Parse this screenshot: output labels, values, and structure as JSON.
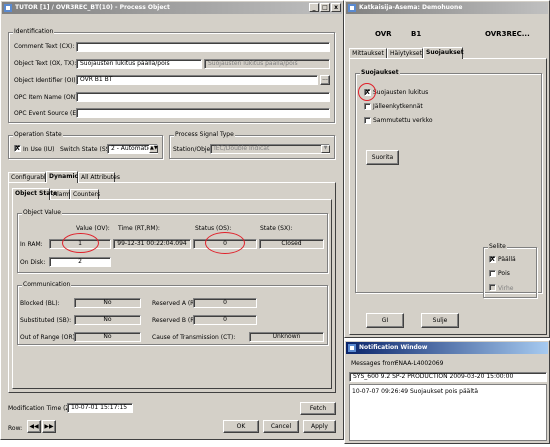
{
  "process_window": {
    "title": "TUTOR [1] / OVR3REC_BT(10) - Process Object",
    "identification": {
      "group_title": "Identification",
      "comment_text_label": "Comment Text (CX):",
      "comment_text_value": "",
      "object_text_label": "Object Text (OX, TX):",
      "object_text_value": "Suojausten lukitus päällä/pois",
      "object_text_value2": "Suojausten lukitus päällä/pois",
      "object_identifier_label": "Object Identifier (OI):",
      "object_identifier_value": "OVR      B1        BT",
      "opc_item_label": "OPC Item Name (ON):",
      "opc_item_value": "",
      "opc_event_label": "OPC Event Source (ES):",
      "opc_event_value": "",
      "browse_label": "..."
    },
    "operation_state": {
      "group_title": "Operation State",
      "in_use_label": "In Use (IU)",
      "in_use_checked": "X",
      "switch_state_label": "Switch State (SS):",
      "switch_state_value": "2 - Automatic"
    },
    "process_signal": {
      "group_title": "Process Signal Type",
      "station_label": "Station/Object:",
      "station_value": "IEC/Double Indicat"
    },
    "tabs": [
      "Configurable",
      "Dynamic",
      "All Attributes"
    ],
    "subtabs": [
      "Object State",
      "Alarm",
      "Counters"
    ],
    "object_value": {
      "group_title": "Object Value",
      "col_value": "Value (OV):",
      "col_time": "Time (RT,RM):",
      "col_status": "Status (OS):",
      "col_state": "State (SX):",
      "in_ram_label": "In RAM:",
      "in_ram_value": "1",
      "in_ram_time": "99-12-31  00:22:04.094",
      "in_ram_status": "0",
      "in_ram_state": "Closed",
      "on_disk_label": "On Disk:",
      "on_disk_value": "2"
    },
    "communication": {
      "group_title": "Communication",
      "blocked_label": "Blocked (BL):",
      "blocked_value": "No",
      "substituted_label": "Substituted (SB):",
      "substituted_value": "No",
      "out_of_range_label": "Out of Range (OR):",
      "out_of_range_value": "No",
      "reserved_a_label": "Reserved A (RA):",
      "reserved_a_value": "0",
      "reserved_b_label": "Reserved B (RB):",
      "reserved_b_value": "0",
      "cause_label": "Cause of Transmission (CT):",
      "cause_value": "Unknown"
    },
    "fetch_label": "Fetch",
    "modification_time_label": "Modification Time (ZT):",
    "modification_time_value": "10-07-01  15:17:15",
    "row_label": "Row:",
    "ok_label": "OK",
    "cancel_label": "Cancel",
    "apply_label": "Apply"
  },
  "control_window": {
    "title": "Katkaisija-Asema: Demohuone",
    "header_left": "OVR",
    "header_mid": "B1",
    "header_right": "OVR3REC...",
    "tabs": [
      "Mittaukset",
      "Häiytykset",
      "Suojaukset"
    ],
    "group_title": "Suojaukset",
    "items": [
      {
        "label": "Suojausten lukitus",
        "checked": "X"
      },
      {
        "label": "Jälleenkytkennät",
        "checked": ""
      },
      {
        "label": "Sammutettu verkko",
        "checked": ""
      }
    ],
    "suorita_label": "Suorita",
    "selite": {
      "group_title": "Selite",
      "items": [
        {
          "label": "Päällä",
          "checked": "X"
        },
        {
          "label": "Pois",
          "checked": ""
        },
        {
          "label": "Virhe",
          "checked": ""
        }
      ]
    },
    "gi_label": "GI",
    "sulje_label": "Sulje"
  },
  "notification_window": {
    "title": "Notification Window",
    "messages_from_label": "Messages from:",
    "messages_from_value": "FNAA-L4002069",
    "version_line": "SYS_600  9.2 SP-2  PRODUCTION  2009-03-20 15:00:00",
    "message": "10-07-07 09:26:49 Suojaukset pois päältä"
  },
  "colors": {
    "annotation": "#e0202a",
    "active_title": "#0a246a",
    "face": "#d4d0c8"
  }
}
